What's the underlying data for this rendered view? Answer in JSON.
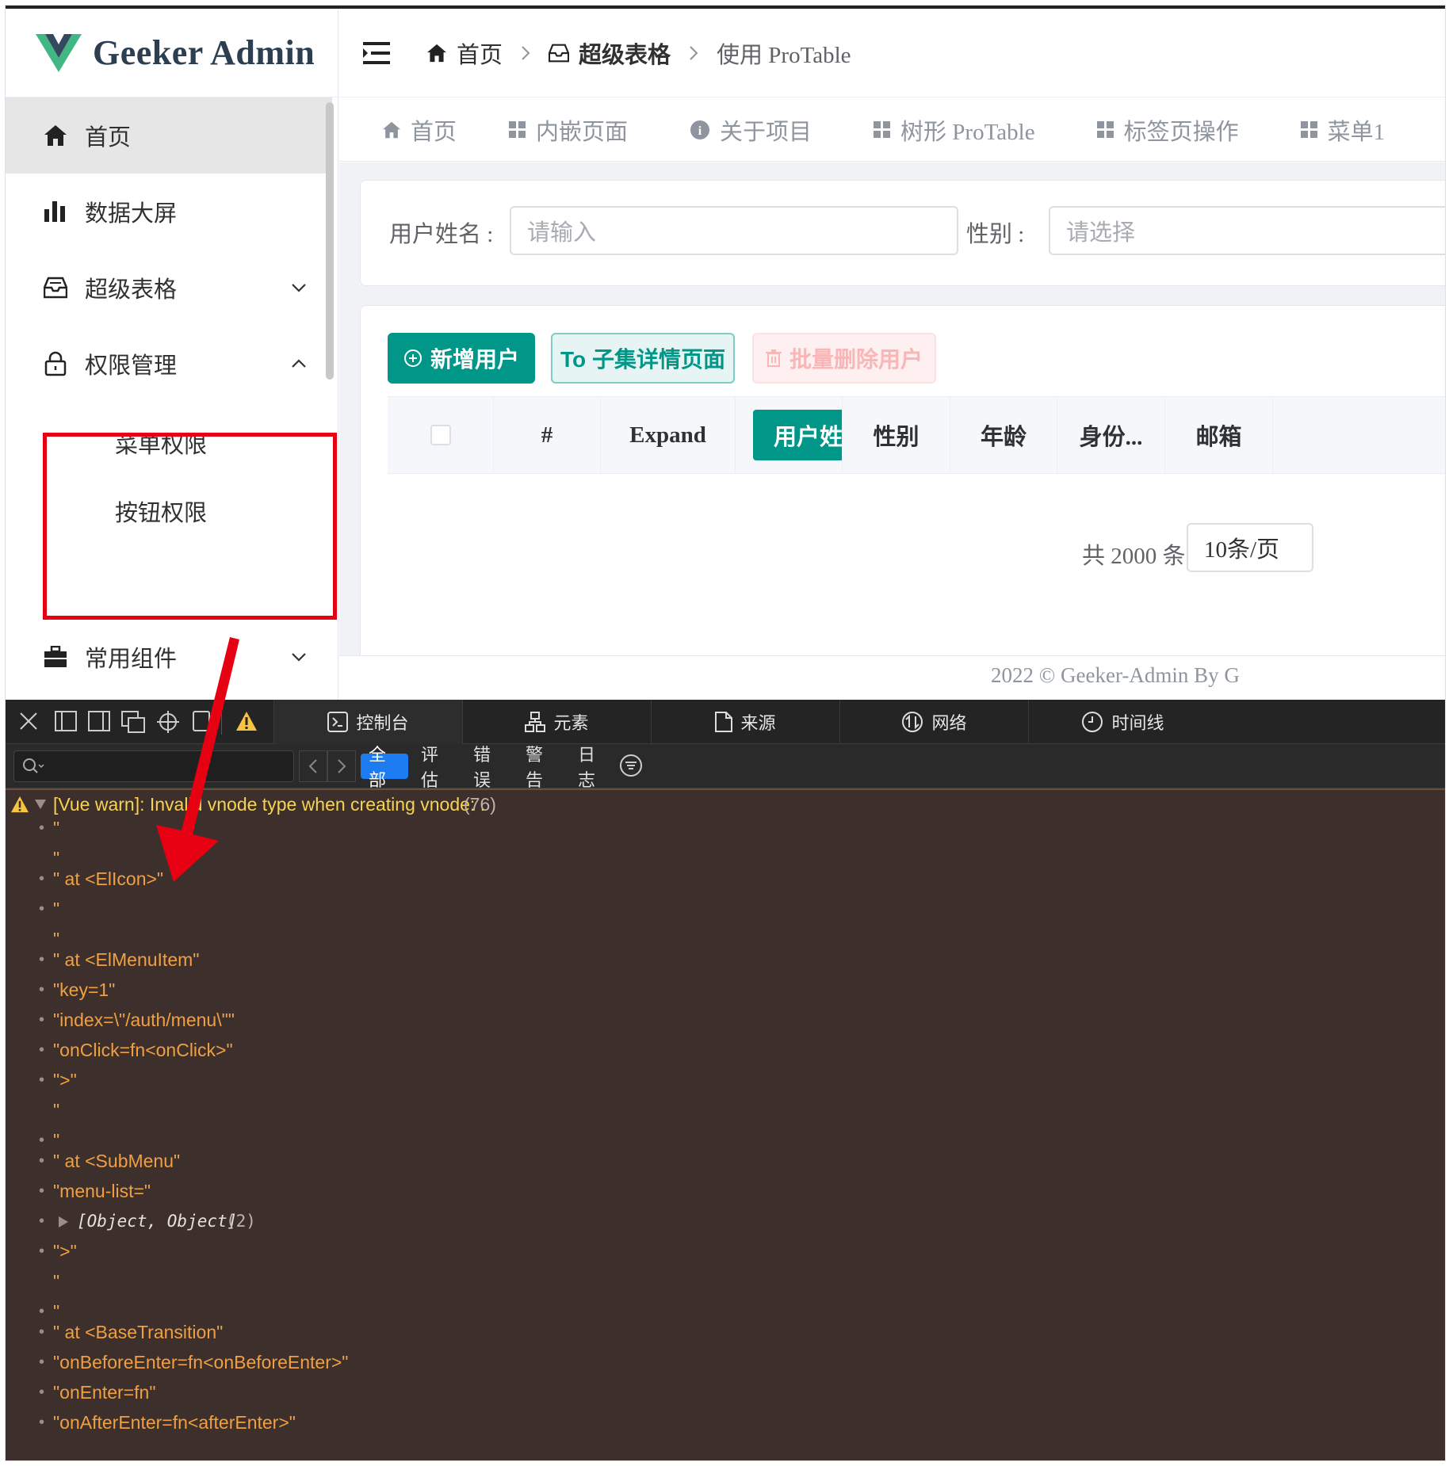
{
  "app": {
    "logo_text": "Geeker Admin",
    "footer": "2022 © Geeker-Admin By G"
  },
  "sidebar": {
    "items": [
      {
        "label": "首页",
        "icon": "home-icon"
      },
      {
        "label": "数据大屏",
        "icon": "bar-chart-icon"
      },
      {
        "label": "超级表格",
        "icon": "inbox-icon"
      },
      {
        "label": "权限管理",
        "icon": "lock-icon"
      },
      {
        "label": "常用组件",
        "icon": "briefcase-icon"
      }
    ],
    "submenu": [
      {
        "label": "菜单权限"
      },
      {
        "label": "按钮权限"
      }
    ]
  },
  "breadcrumb": {
    "items": [
      "首页",
      "超级表格",
      "使用 ProTable"
    ]
  },
  "tabs": [
    {
      "label": "首页",
      "icon": "home-icon"
    },
    {
      "label": "内嵌页面",
      "icon": "grid-icon"
    },
    {
      "label": "关于项目",
      "icon": "info-icon"
    },
    {
      "label": "树形 ProTable",
      "icon": "grid-icon"
    },
    {
      "label": "标签页操作",
      "icon": "grid-icon"
    },
    {
      "label": "菜单1",
      "icon": "grid-icon"
    }
  ],
  "search": {
    "username_label": "用户姓名 :",
    "username_placeholder": "请输入",
    "gender_label": "性别 :",
    "gender_placeholder": "请选择"
  },
  "toolbar": {
    "add_user": "新增用户",
    "to_detail": "To 子集详情页面",
    "batch_delete": "批量删除用户"
  },
  "table": {
    "headers": [
      "#",
      "Expand",
      "用户姓名",
      "性别",
      "年龄",
      "身份...",
      "邮箱"
    ]
  },
  "pagination": {
    "total": "共 2000 条",
    "page_size": "10条/页"
  },
  "devtools": {
    "tabs": [
      "控制台",
      "元素",
      "来源",
      "网络",
      "时间线"
    ],
    "filters": [
      "全部",
      "评估",
      "错误",
      "警告",
      "日志"
    ],
    "active_filter": "全部",
    "warning_head": "[Vue warn]: Invalid vnode type when creating vnode: .",
    "warning_count": "(76)",
    "lines": [
      "\"",
      "\"",
      "\" at <ElIcon>\"",
      "\"",
      "\"",
      "\" at <ElMenuItem\"",
      "\"key=1\"",
      "\"index=\\\"/auth/menu\\\"\"",
      "\"onClick=fn<onClick>\"",
      "\">\"",
      "\"",
      "\"",
      "\" at <SubMenu\"",
      "\"menu-list=\"",
      "[Object, Object]",
      "\">\"",
      "\"",
      "\"",
      "\" at <BaseTransition\"",
      "\"onBeforeEnter=fn<onBeforeEnter>\"",
      "\"onEnter=fn\"",
      "\"onAfterEnter=fn<afterEnter>\""
    ],
    "object_count": "(2)"
  },
  "colors": {
    "primary": "#009688",
    "warning_text": "#f0a043",
    "console_bg": "#3d2f2b",
    "annotation_red": "#e60012"
  }
}
